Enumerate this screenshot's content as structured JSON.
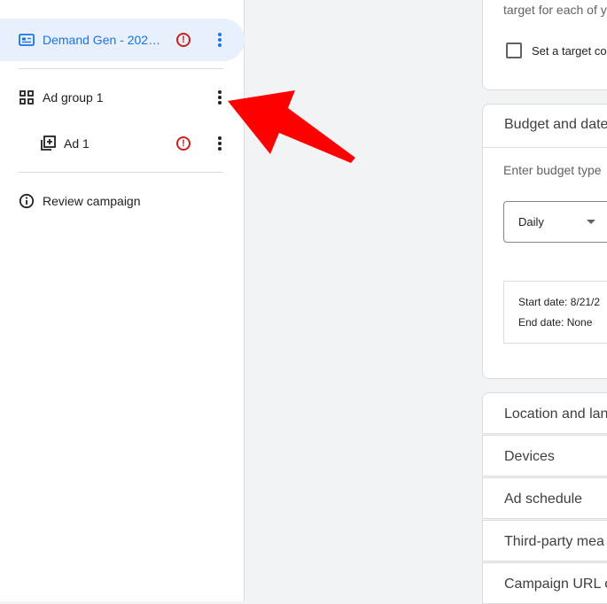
{
  "sidebar": {
    "campaign": {
      "label": "Demand Gen - 202…",
      "icon": "campaign-card-icon",
      "status": "error",
      "accent": "#1a73e8"
    },
    "ad_group": {
      "label": "Ad group 1",
      "icon": "grid-icon"
    },
    "ad": {
      "label": "Ad 1",
      "icon": "ad-add-icon",
      "status": "error"
    },
    "review": {
      "label": "Review campaign",
      "icon": "info-icon"
    }
  },
  "main": {
    "top_card": {
      "hint": "target for each of y",
      "checkbox_label": "Set a target co"
    },
    "budget_card": {
      "title": "Budget and date",
      "prompt": "Enter budget type",
      "budget_type": "Daily",
      "start_date": "Start date: 8/21/2",
      "end_date": "End date: None"
    },
    "sections": [
      {
        "title": "Location and lan"
      },
      {
        "title": "Devices"
      },
      {
        "title": "Ad schedule"
      },
      {
        "title": "Third-party mea"
      },
      {
        "title": "Campaign URL o"
      }
    ]
  },
  "colors": {
    "error": "#c5221f",
    "annotation_arrow": "#ff0000"
  }
}
